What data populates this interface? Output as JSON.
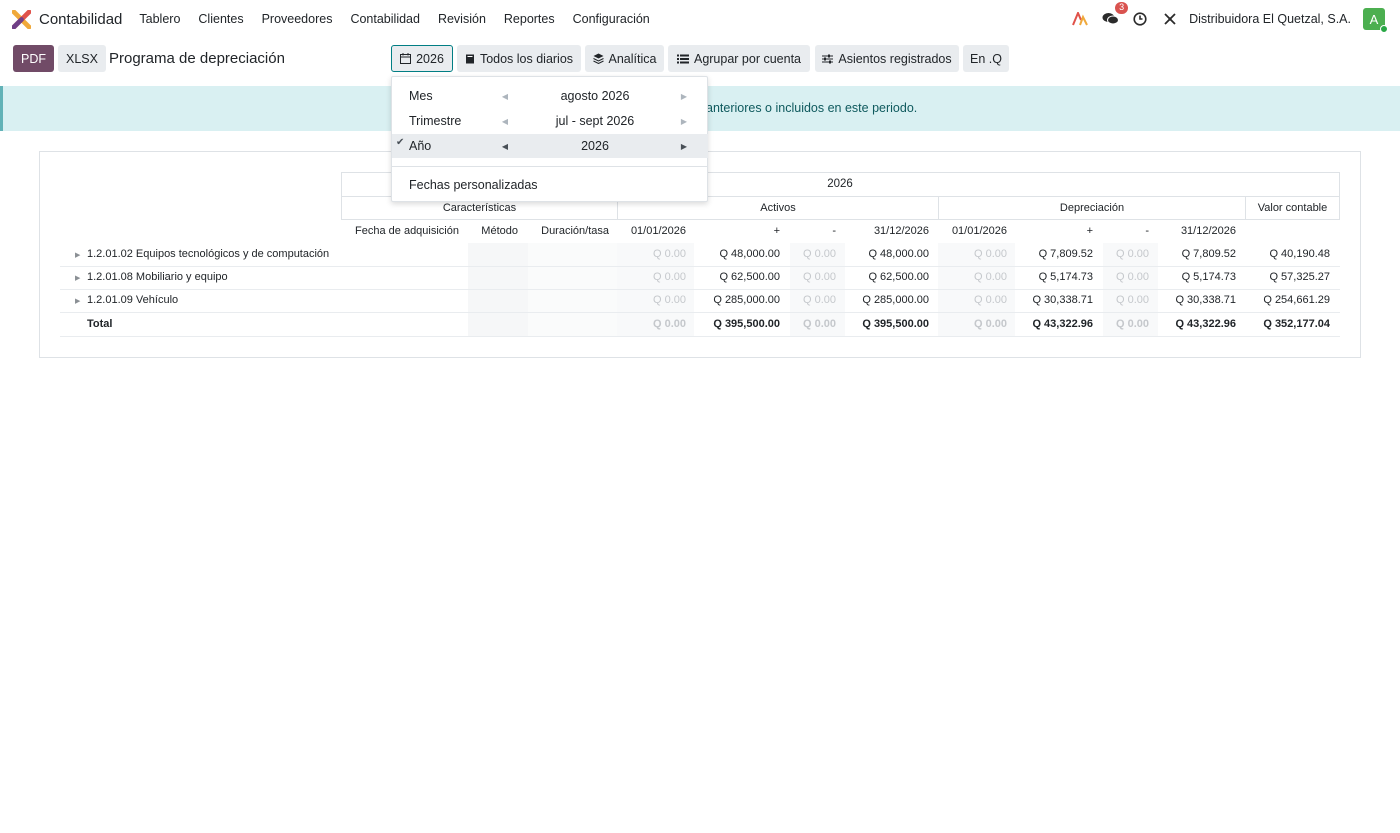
{
  "app": {
    "name": "Contabilidad",
    "menu": [
      "Tablero",
      "Clientes",
      "Proveedores",
      "Contabilidad",
      "Revisión",
      "Reportes",
      "Configuración"
    ],
    "messages_badge": "3",
    "company": "Distribuidora El Quetzal, S.A.",
    "avatar_letter": "A",
    "brand_color": "#714b67"
  },
  "toolbar": {
    "pdf_label": "PDF",
    "xlsx_label": "XLSX",
    "title": "Programa de depreciación",
    "filters": {
      "date": "2026",
      "journals": "Todos los diarios",
      "analytic": "Analítica",
      "group_by": "Agrupar por cuenta",
      "entries": "Asientos registrados",
      "currency": "En .Q"
    }
  },
  "alert": {
    "text": "anteriores o incluidos en este periodo."
  },
  "date_dropdown": {
    "rows": [
      {
        "label": "Mes",
        "value": "agosto 2026"
      },
      {
        "label": "Trimestre",
        "value": "jul - sept 2026"
      },
      {
        "label": "Año",
        "value": "2026"
      }
    ],
    "custom_label": "Fechas personalizadas"
  },
  "report": {
    "period": "2026",
    "groups": {
      "characteristics": "Características",
      "assets": "Activos",
      "depreciation": "Depreciación",
      "book_value": "Valor contable"
    },
    "columns": [
      "Fecha de adquisición",
      "Método",
      "Duración/tasa",
      "01/01/2026",
      "+",
      "-",
      "31/12/2026",
      "01/01/2026",
      "+",
      "-",
      "31/12/2026"
    ],
    "rows": [
      {
        "name": "1.2.01.02 Equipos tecnológicos y de computación",
        "a_open": "Q 0.00",
        "a_plus": "Q 48,000.00",
        "a_minus": "Q 0.00",
        "a_close": "Q 48,000.00",
        "d_open": "Q 0.00",
        "d_plus": "Q 7,809.52",
        "d_minus": "Q 0.00",
        "d_close": "Q 7,809.52",
        "book": "Q 40,190.48"
      },
      {
        "name": "1.2.01.08 Mobiliario y equipo",
        "a_open": "Q 0.00",
        "a_plus": "Q 62,500.00",
        "a_minus": "Q 0.00",
        "a_close": "Q 62,500.00",
        "d_open": "Q 0.00",
        "d_plus": "Q 5,174.73",
        "d_minus": "Q 0.00",
        "d_close": "Q 5,174.73",
        "book": "Q 57,325.27"
      },
      {
        "name": "1.2.01.09 Vehículo",
        "a_open": "Q 0.00",
        "a_plus": "Q 285,000.00",
        "a_minus": "Q 0.00",
        "a_close": "Q 285,000.00",
        "d_open": "Q 0.00",
        "d_plus": "Q 30,338.71",
        "d_minus": "Q 0.00",
        "d_close": "Q 30,338.71",
        "book": "Q 254,661.29"
      }
    ],
    "total": {
      "name": "Total",
      "a_open": "Q 0.00",
      "a_plus": "Q 395,500.00",
      "a_minus": "Q 0.00",
      "a_close": "Q 395,500.00",
      "d_open": "Q 0.00",
      "d_plus": "Q 43,322.96",
      "d_minus": "Q 0.00",
      "d_close": "Q 43,322.96",
      "book": "Q 352,177.04"
    }
  }
}
